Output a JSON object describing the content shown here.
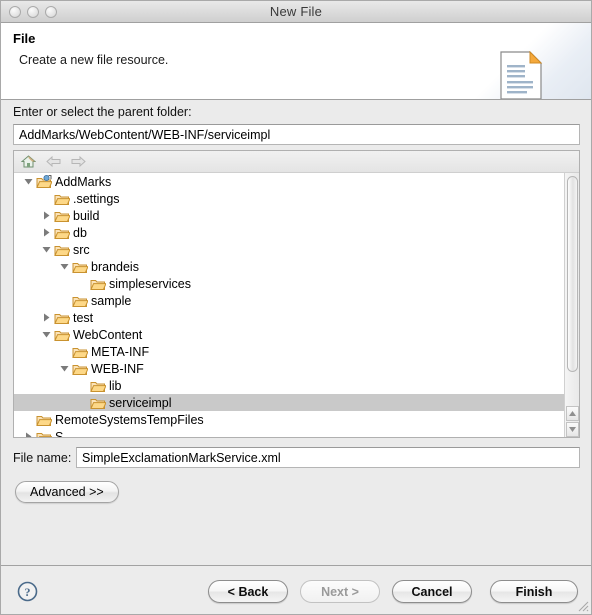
{
  "window": {
    "title": "New File",
    "traffic_lights": [
      "close-button",
      "minimize-button",
      "zoom-button"
    ]
  },
  "header": {
    "title": "File",
    "description": "Create a new file resource.",
    "icon": "new-file-document-icon"
  },
  "parent_folder": {
    "label": "Enter or select the parent folder:",
    "value": "AddMarks/WebContent/WEB-INF/serviceimpl",
    "placeholder": ""
  },
  "tree_toolbar": {
    "buttons": [
      {
        "name": "home-icon",
        "enabled": true
      },
      {
        "name": "back-arrow-icon",
        "enabled": false
      },
      {
        "name": "forward-arrow-icon",
        "enabled": false
      }
    ]
  },
  "tree": {
    "rows": [
      {
        "label": "AddMarks",
        "depth": 0,
        "twisty": "down",
        "icon": "project-folder-icon",
        "selected": false
      },
      {
        "label": ".settings",
        "depth": 1,
        "twisty": "none",
        "icon": "folder-icon",
        "selected": false
      },
      {
        "label": "build",
        "depth": 1,
        "twisty": "right",
        "icon": "folder-icon",
        "selected": false
      },
      {
        "label": "db",
        "depth": 1,
        "twisty": "right",
        "icon": "folder-icon",
        "selected": false
      },
      {
        "label": "src",
        "depth": 1,
        "twisty": "down",
        "icon": "folder-icon",
        "selected": false
      },
      {
        "label": "brandeis",
        "depth": 2,
        "twisty": "down",
        "icon": "folder-icon",
        "selected": false
      },
      {
        "label": "simpleservices",
        "depth": 3,
        "twisty": "none",
        "icon": "folder-icon",
        "selected": false
      },
      {
        "label": "sample",
        "depth": 2,
        "twisty": "none",
        "icon": "folder-icon",
        "selected": false
      },
      {
        "label": "test",
        "depth": 1,
        "twisty": "right",
        "icon": "folder-icon",
        "selected": false
      },
      {
        "label": "WebContent",
        "depth": 1,
        "twisty": "down",
        "icon": "folder-icon",
        "selected": false
      },
      {
        "label": "META-INF",
        "depth": 2,
        "twisty": "none",
        "icon": "folder-icon",
        "selected": false
      },
      {
        "label": "WEB-INF",
        "depth": 2,
        "twisty": "down",
        "icon": "folder-icon",
        "selected": false
      },
      {
        "label": "lib",
        "depth": 3,
        "twisty": "none",
        "icon": "folder-icon",
        "selected": false
      },
      {
        "label": "serviceimpl",
        "depth": 3,
        "twisty": "none",
        "icon": "folder-icon",
        "selected": true
      },
      {
        "label": "RemoteSystemsTempFiles",
        "depth": 0,
        "twisty": "none",
        "icon": "folder-icon",
        "selected": false
      },
      {
        "label": "S",
        "depth": 0,
        "twisty": "right",
        "icon": "folder-icon",
        "selected": false
      }
    ],
    "scrollbar": {
      "orientation": "vertical",
      "thumb_position": "top"
    }
  },
  "file_name": {
    "label": "File name:",
    "value": "SimpleExclamationMarkService.xml",
    "placeholder": ""
  },
  "advanced": {
    "label": "Advanced >>"
  },
  "footer": {
    "help": "help-icon",
    "buttons": [
      {
        "label": "< Back",
        "enabled": true
      },
      {
        "label": "Next >",
        "enabled": false
      },
      {
        "label": "Cancel",
        "enabled": true
      },
      {
        "label": "Finish",
        "enabled": true
      }
    ]
  },
  "colors": {
    "selection": "#c9c9c9",
    "window_bg": "#ebebeb",
    "folder": "#f0ad4e",
    "accent": "#4a6a8a"
  }
}
